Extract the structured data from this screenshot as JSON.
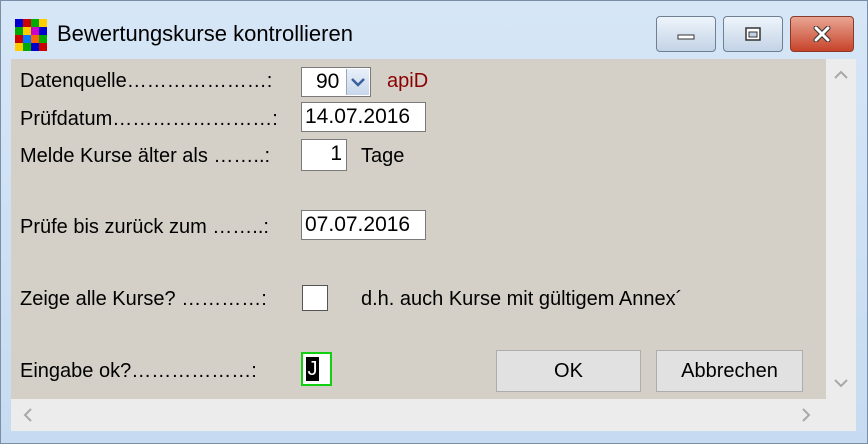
{
  "window": {
    "title": "Bewertungskurse kontrollieren"
  },
  "titlebar_buttons": {
    "minimize_icon": "minimize-icon",
    "maximize_icon": "maximize-icon",
    "close_icon": "close-icon"
  },
  "form": {
    "datenquelle": {
      "label": "Datenquelle",
      "dots": "…………………:",
      "value": "90",
      "suffix": "apiD"
    },
    "pruefdatum": {
      "label": "Prüfdatum",
      "dots": "……………………:",
      "value": "14.07.2016"
    },
    "melde": {
      "label": "Melde Kurse älter als ",
      "dots": "……..:",
      "value": "1",
      "unit": "Tage"
    },
    "pruefe_bis": {
      "label": "Prüfe bis zurück zum ",
      "dots": "……..:",
      "value": "07.07.2016"
    },
    "zeige_alle": {
      "label": "Zeige alle Kurse? ",
      "dots": "…………:",
      "checked": false,
      "hint": "d.h. auch Kurse mit gültigem Annex´"
    },
    "eingabe_ok": {
      "label": "Eingabe ok?",
      "dots": "………………:",
      "value": "J"
    }
  },
  "buttons": {
    "ok": "OK",
    "cancel": "Abbrechen"
  },
  "colors": {
    "suffix_text": "#8b0000",
    "dialog_bg": "#d4d0c8",
    "focus_border": "#10d010",
    "close_button": "#c8432a"
  }
}
